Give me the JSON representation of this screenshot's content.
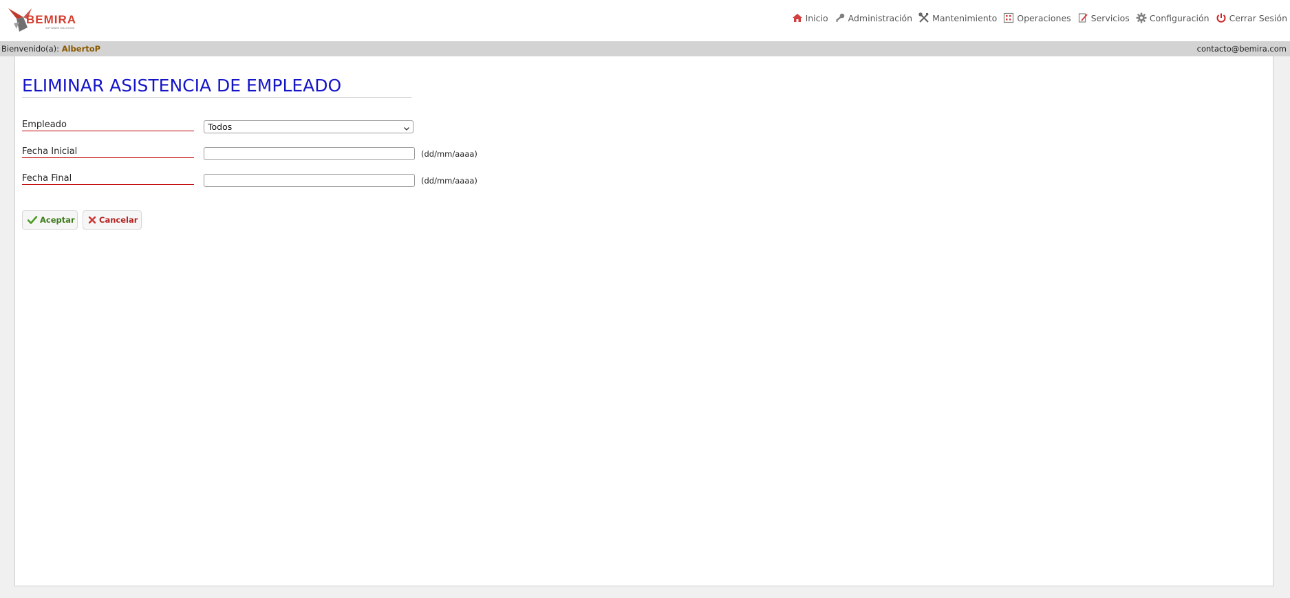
{
  "header": {
    "logo_text": "BEMIRA",
    "logo_tagline": "SOFTWARE SOLUTIONS",
    "nav": [
      {
        "label": "Inicio",
        "icon": "home-icon"
      },
      {
        "label": "Administración",
        "icon": "key-icon"
      },
      {
        "label": "Mantenimiento",
        "icon": "tools-icon"
      },
      {
        "label": "Operaciones",
        "icon": "grid-icon"
      },
      {
        "label": "Servicios",
        "icon": "edit-document-icon"
      },
      {
        "label": "Configuración",
        "icon": "gear-icon"
      },
      {
        "label": "Cerrar Sesión",
        "icon": "power-icon"
      }
    ]
  },
  "welcome": {
    "prefix": "Bienvenido(a):",
    "user": "AlbertoP",
    "contact": "contacto@bemira.com"
  },
  "form": {
    "title": "ELIMINAR ASISTENCIA DE EMPLEADO",
    "employee_label": "Empleado",
    "employee_value": "Todos",
    "start_label": "Fecha Inicial",
    "start_value": "",
    "start_hint": "(dd/mm/aaaa)",
    "end_label": "Fecha Final",
    "end_value": "",
    "end_hint": "(dd/mm/aaaa)",
    "accept_label": "Aceptar",
    "cancel_label": "Cancelar"
  },
  "colors": {
    "title": "#1515c8",
    "label_underline": "#c00000",
    "username": "#8a5a00",
    "accept": "#3d7a1a",
    "cancel": "#b22222",
    "nav_home": "#d04040",
    "nav_power": "#d02020"
  }
}
